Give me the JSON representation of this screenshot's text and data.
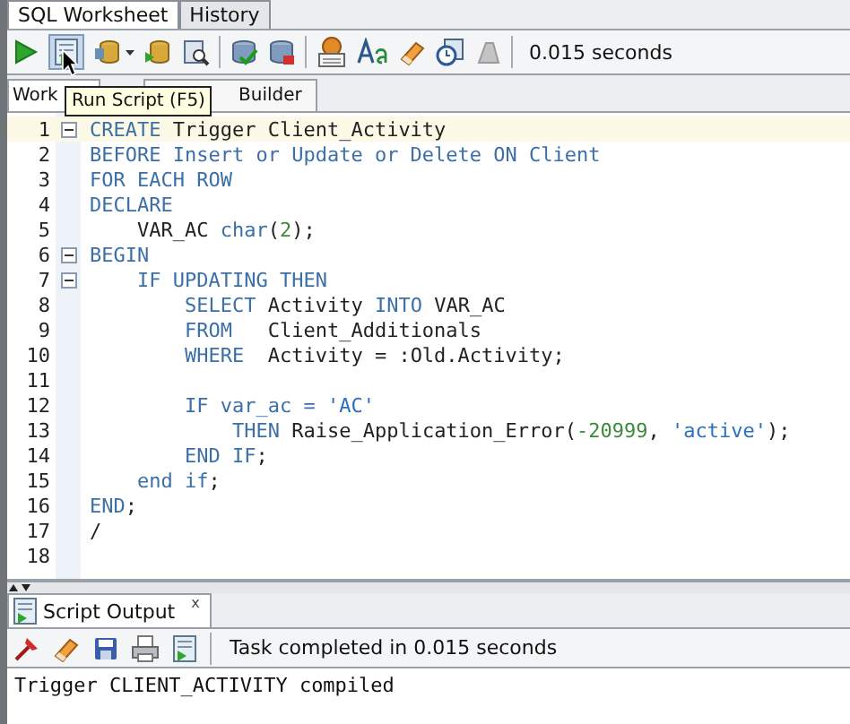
{
  "tabs": [
    {
      "label": "SQL Worksheet",
      "selected": true
    },
    {
      "label": "History",
      "selected": false
    }
  ],
  "toolbar": {
    "status": "0.015 seconds"
  },
  "tooltip": "Run Script (F5)",
  "editor_tabs": [
    {
      "label": "Work",
      "selected": true
    },
    {
      "label": "Builder",
      "selected": false
    }
  ],
  "lines": [
    {
      "number": "1",
      "fold": true,
      "current": true,
      "tokens": [
        {
          "text": "CREATE ",
          "kind": "keyword"
        },
        {
          "text": "Trigger Client_Activity",
          "kind": "identifier"
        }
      ]
    },
    {
      "number": "2",
      "fold": false,
      "current": false,
      "tokens": [
        {
          "text": "BEFORE Insert or Update or Delete ON Client",
          "kind": "keyword"
        }
      ]
    },
    {
      "number": "3",
      "fold": false,
      "current": false,
      "tokens": [
        {
          "text": "FOR EACH ROW",
          "kind": "keyword"
        }
      ]
    },
    {
      "number": "4",
      "fold": false,
      "current": false,
      "tokens": [
        {
          "text": "DECLARE",
          "kind": "keyword"
        }
      ]
    },
    {
      "number": "5",
      "fold": false,
      "current": false,
      "tokens": [
        {
          "text": "    VAR_AC ",
          "kind": "identifier"
        },
        {
          "text": "char",
          "kind": "keyword"
        },
        {
          "text": "(",
          "kind": "identifier"
        },
        {
          "text": "2",
          "kind": "number"
        },
        {
          "text": ");",
          "kind": "identifier"
        }
      ]
    },
    {
      "number": "6",
      "fold": true,
      "current": false,
      "tokens": [
        {
          "text": "BEGIN",
          "kind": "keyword"
        }
      ]
    },
    {
      "number": "7",
      "fold": true,
      "current": false,
      "tokens": [
        {
          "text": "    IF UPDATING THEN",
          "kind": "keyword"
        }
      ]
    },
    {
      "number": "8",
      "fold": false,
      "current": false,
      "tokens": [
        {
          "text": "        SELECT ",
          "kind": "keyword"
        },
        {
          "text": "Activity ",
          "kind": "identifier"
        },
        {
          "text": "INTO ",
          "kind": "keyword"
        },
        {
          "text": "VAR_AC",
          "kind": "identifier"
        }
      ]
    },
    {
      "number": "9",
      "fold": false,
      "current": false,
      "tokens": [
        {
          "text": "        FROM   ",
          "kind": "keyword"
        },
        {
          "text": "Client_Additionals",
          "kind": "identifier"
        }
      ]
    },
    {
      "number": "10",
      "fold": false,
      "current": false,
      "tokens": [
        {
          "text": "        WHERE  ",
          "kind": "keyword"
        },
        {
          "text": "Activity = :Old.Activity;",
          "kind": "identifier"
        }
      ]
    },
    {
      "number": "11",
      "fold": false,
      "current": false
    },
    {
      "number": "12",
      "fold": false,
      "current": false,
      "tokens": [
        {
          "text": "        IF ",
          "kind": "keyword"
        },
        {
          "text": "var_ac = ",
          "kind": "keyword"
        },
        {
          "text": "'AC'",
          "kind": "string"
        }
      ]
    },
    {
      "number": "13",
      "fold": false,
      "current": false,
      "tokens": [
        {
          "text": "            THEN ",
          "kind": "keyword"
        },
        {
          "text": "Raise_Application_Error(",
          "kind": "identifier"
        },
        {
          "text": "-20999",
          "kind": "number"
        },
        {
          "text": ", ",
          "kind": "identifier"
        },
        {
          "text": "'active'",
          "kind": "string"
        },
        {
          "text": ");",
          "kind": "identifier"
        }
      ]
    },
    {
      "number": "14",
      "fold": false,
      "current": false,
      "tokens": [
        {
          "text": "        END IF",
          "kind": "keyword"
        },
        {
          "text": ";",
          "kind": "identifier"
        }
      ]
    },
    {
      "number": "15",
      "fold": false,
      "current": false,
      "tokens": [
        {
          "text": "    end if",
          "kind": "keyword"
        },
        {
          "text": ";",
          "kind": "identifier"
        }
      ]
    },
    {
      "number": "16",
      "fold": false,
      "current": false,
      "tokens": [
        {
          "text": "END",
          "kind": "keyword"
        },
        {
          "text": ";",
          "kind": "identifier"
        }
      ]
    },
    {
      "number": "17",
      "fold": false,
      "current": false,
      "tokens": [
        {
          "text": "/",
          "kind": "identifier"
        }
      ]
    },
    {
      "number": "18",
      "fold": false,
      "current": false
    }
  ],
  "output_panel": {
    "tab": {
      "label": "Script Output",
      "close": "x"
    },
    "status": "Task completed in 0.015 seconds",
    "text": "Trigger CLIENT_ACTIVITY compiled"
  }
}
